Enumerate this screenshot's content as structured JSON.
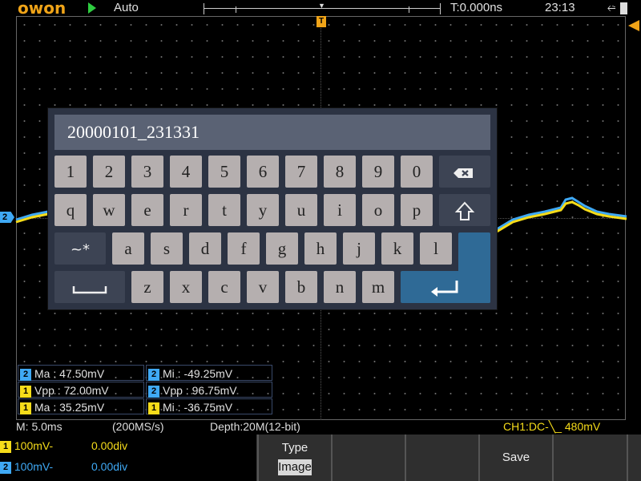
{
  "topbar": {
    "logo": "OWON",
    "trigger_mode": "Auto",
    "time_offset": "T:0.000ns",
    "clock": "23:13",
    "usb_icon": "usb-icon",
    "battery_icon": "battery-icon"
  },
  "markers": {
    "trigger_position": "T",
    "channel2": "2"
  },
  "keyboard": {
    "filename": "20000101_231331",
    "row1": [
      "1",
      "2",
      "3",
      "4",
      "5",
      "6",
      "7",
      "8",
      "9",
      "0"
    ],
    "row2": [
      "q",
      "w",
      "e",
      "r",
      "t",
      "y",
      "u",
      "i",
      "o",
      "p"
    ],
    "row3": [
      "a",
      "s",
      "d",
      "f",
      "g",
      "h",
      "j",
      "k",
      "l"
    ],
    "row4": [
      "z",
      "x",
      "c",
      "v",
      "b",
      "n",
      "m"
    ],
    "symbols_key": "~*",
    "backspace_icon": "backspace-icon",
    "shift_icon": "shift-icon",
    "space_icon": "space-icon",
    "enter_icon": "enter-icon"
  },
  "measurements": [
    {
      "ch": "2",
      "text": "Ma : 47.50mV"
    },
    {
      "ch": "2",
      "text": "Mi : -49.25mV"
    },
    {
      "ch": "1",
      "text": "Vpp : 72.00mV"
    },
    {
      "ch": "2",
      "text": "Vpp : 96.75mV"
    },
    {
      "ch": "1",
      "text": "Ma : 35.25mV"
    },
    {
      "ch": "1",
      "text": "Mi : -36.75mV"
    }
  ],
  "status": {
    "timebase": "M: 5.0ms",
    "sample_rate": "(200MS/s)",
    "depth": "Depth:20M(12-bit)",
    "ch1_trigger": "CH1:DC-╲_ 480mV"
  },
  "channels": [
    {
      "num": "1",
      "scale": "100mV-",
      "offset": "0.00div",
      "color": "#f6dc1a"
    },
    {
      "num": "2",
      "scale": "100mV-",
      "offset": "0.00div",
      "color": "#3fa9f5"
    }
  ],
  "menu": {
    "type_label": "Type",
    "type_value": "Image",
    "save_label": "Save"
  },
  "colors": {
    "ch1": "#f6dc1a",
    "ch2": "#3fa9f5",
    "accent": "#f0a418",
    "keyboard_bg": "#2c3343",
    "enter_key": "#2f6a96"
  }
}
